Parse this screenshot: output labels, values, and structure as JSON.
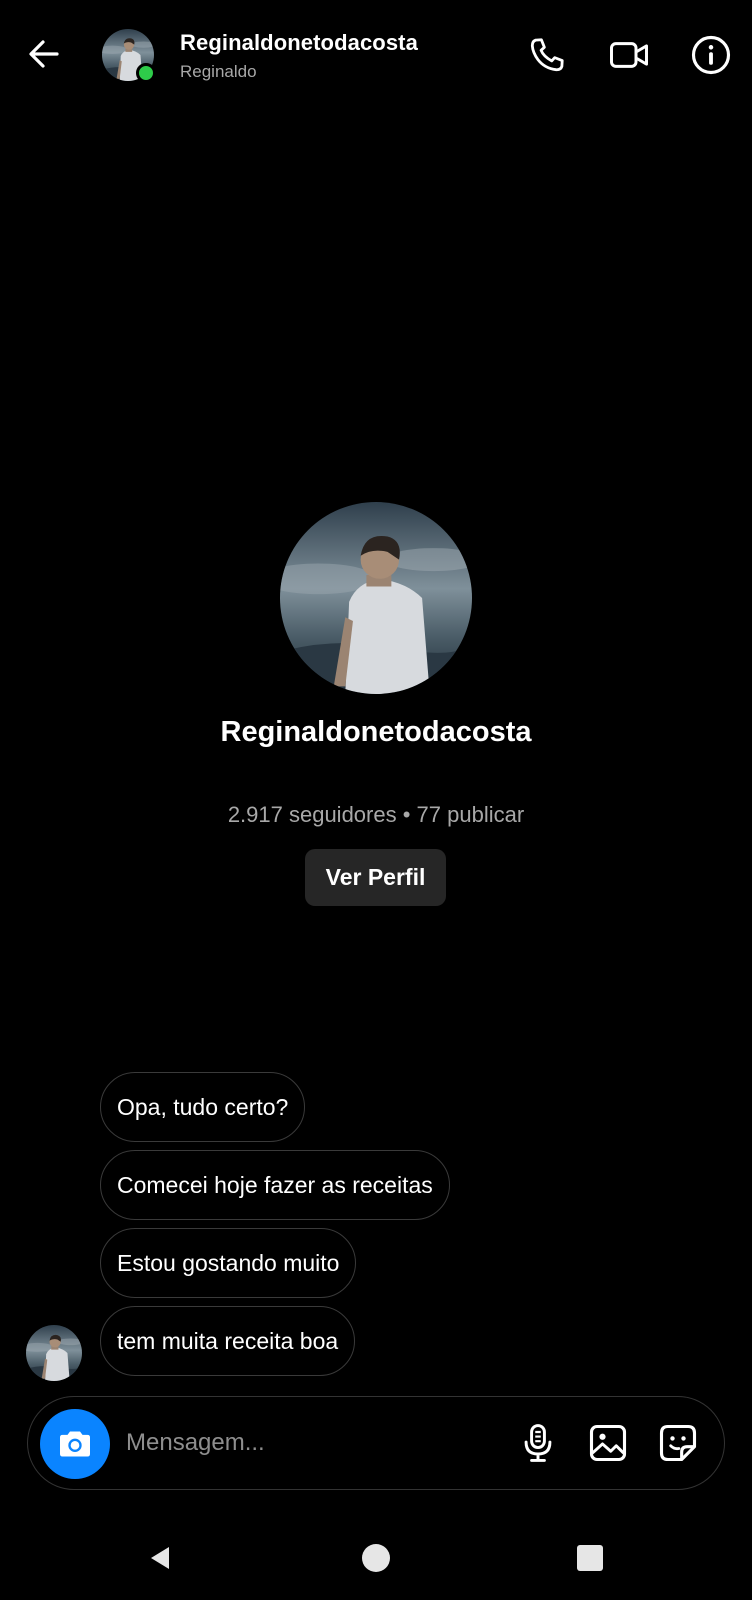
{
  "header": {
    "username": "Reginaldonetodacosta",
    "display_name": "Reginaldo",
    "online": true,
    "online_color": "#2ecc4a",
    "icons": [
      "back-arrow-icon",
      "phone-icon",
      "video-camera-icon",
      "info-icon"
    ]
  },
  "profile": {
    "username": "Reginaldonetodacosta",
    "stats": "2.917 seguidores • 77 publicar",
    "view_profile_label": "Ver Perfil"
  },
  "messages": [
    {
      "text": "Opa, tudo certo?"
    },
    {
      "text": "Comecei hoje fazer as receitas"
    },
    {
      "text": "Estou gostando muito"
    },
    {
      "text": "tem muita receita boa"
    }
  ],
  "composer": {
    "placeholder": "Mensagem...",
    "accent": "#0a84ff",
    "icons": [
      "camera-icon",
      "microphone-icon",
      "gallery-icon",
      "sticker-icon"
    ]
  },
  "system_nav": {
    "icons": [
      "nav-back-icon",
      "nav-home-icon",
      "nav-recents-icon"
    ]
  }
}
